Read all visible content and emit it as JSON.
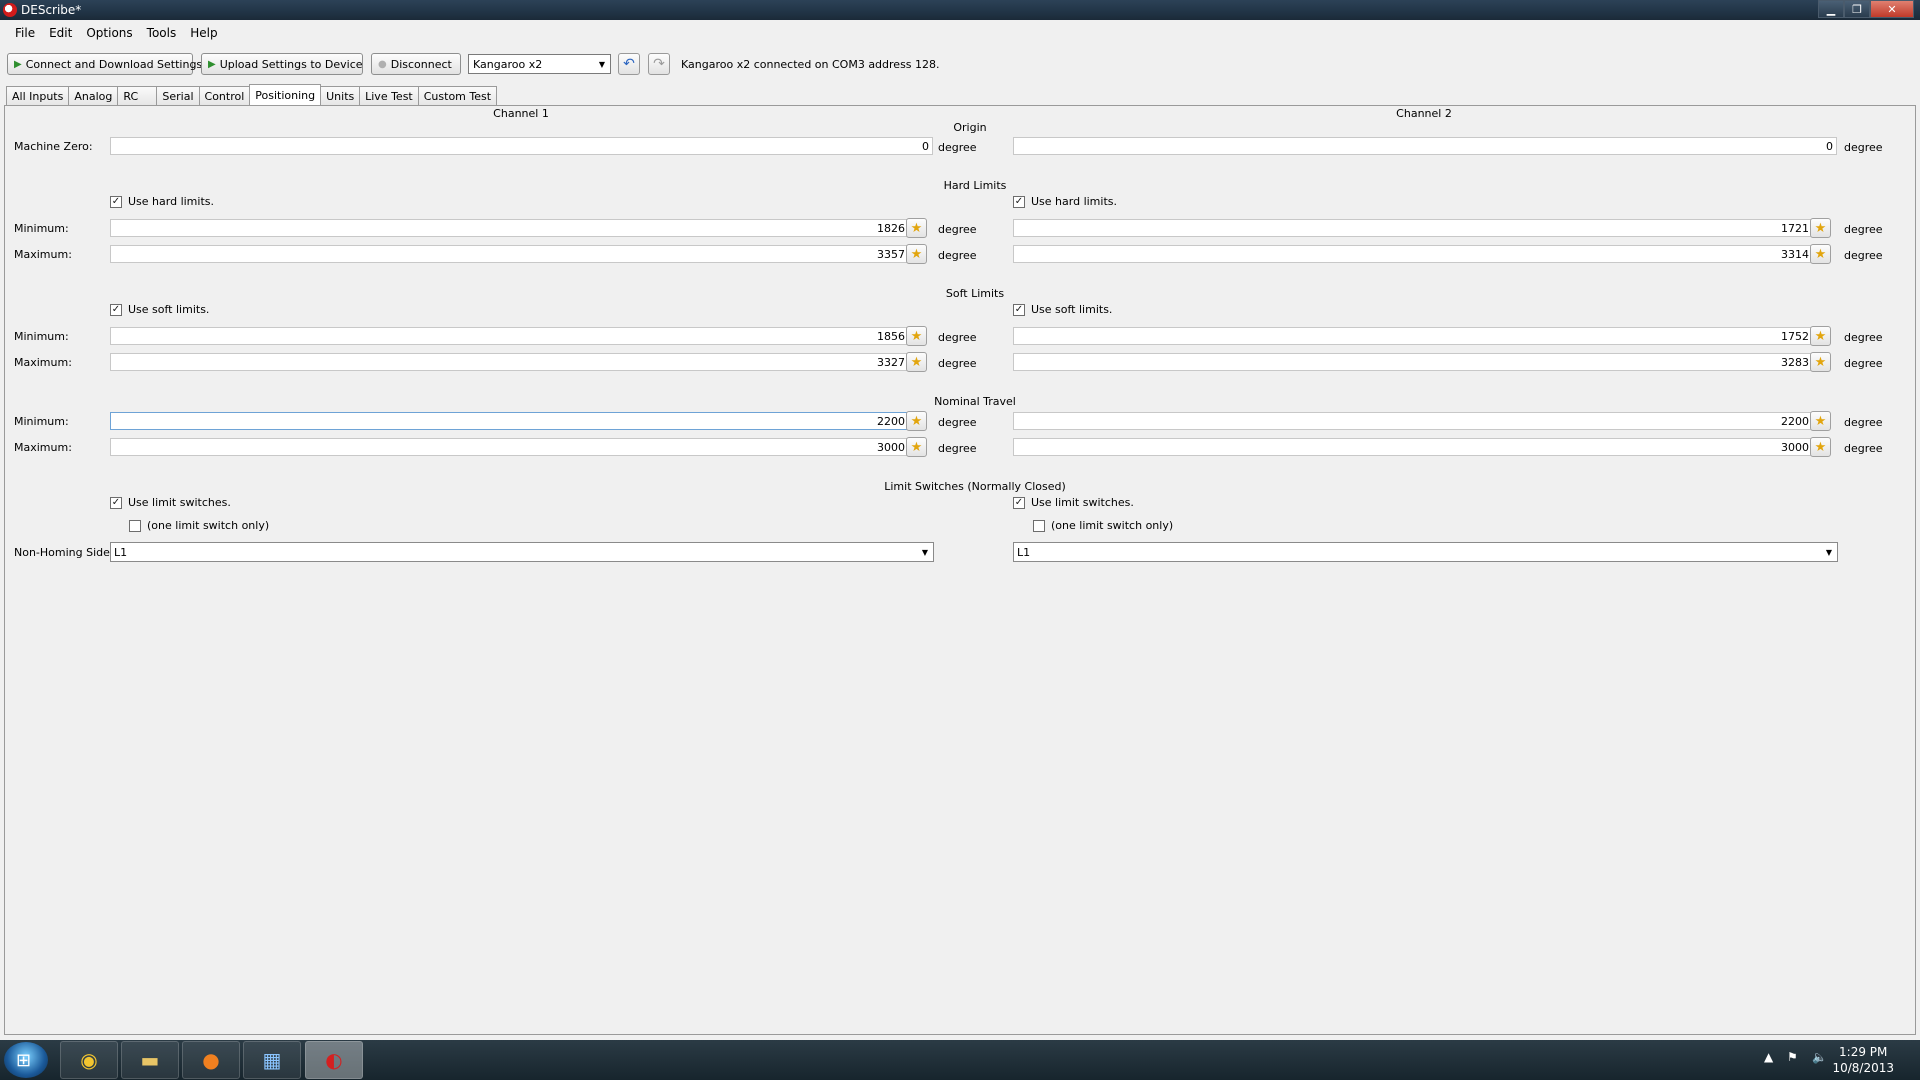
{
  "window": {
    "title": "DEScribe*"
  },
  "menu": {
    "items": [
      "File",
      "Edit",
      "Options",
      "Tools",
      "Help"
    ]
  },
  "toolbar": {
    "connect_label": "Connect and Download Settings",
    "upload_label": "Upload Settings to Device",
    "disconnect_label": "Disconnect",
    "device_selected": "Kangaroo x2",
    "status": "Kangaroo x2 connected on COM3 address 128."
  },
  "tabs": [
    "All Inputs",
    "Analog",
    "RC",
    "Serial",
    "Control",
    "Positioning",
    "Units",
    "Live Test",
    "Custom Test"
  ],
  "active_tab": "Positioning",
  "form": {
    "channel1_title": "Channel 1",
    "channel2_title": "Channel 2",
    "unit": "degree",
    "sections": {
      "origin": "Origin",
      "hard_limits": "Hard Limits",
      "soft_limits": "Soft Limits",
      "nominal_travel": "Nominal Travel",
      "limit_switches": "Limit Switches (Normally Closed)"
    },
    "labels": {
      "machine_zero": "Machine Zero:",
      "minimum": "Minimum:",
      "maximum": "Maximum:",
      "non_homing_side": "Non-Homing Side:",
      "use_hard_limits": "Use hard limits.",
      "use_soft_limits": "Use soft limits.",
      "use_limit_switches": "Use limit switches.",
      "one_limit_switch": "(one limit switch only)"
    },
    "channel1": {
      "machine_zero": "0",
      "use_hard_limits": true,
      "hard_min": "1826",
      "hard_max": "3357",
      "use_soft_limits": true,
      "soft_min": "1856",
      "soft_max": "3327",
      "nominal_min": "2200",
      "nominal_max": "3000",
      "use_limit_switches": true,
      "one_limit_switch": false,
      "non_homing_side": "L1"
    },
    "channel2": {
      "machine_zero": "0",
      "use_hard_limits": true,
      "hard_min": "1721",
      "hard_max": "3314",
      "use_soft_limits": true,
      "soft_min": "1752",
      "soft_max": "3283",
      "nominal_min": "2200",
      "nominal_max": "3000",
      "use_limit_switches": true,
      "one_limit_switch": false,
      "non_homing_side": "L1"
    }
  },
  "taskbar": {
    "apps": [
      "chrome-icon",
      "folder-icon",
      "firefox-icon",
      "control-panel-icon",
      "describe-icon"
    ],
    "time": "1:29 PM",
    "date": "10/8/2013"
  }
}
